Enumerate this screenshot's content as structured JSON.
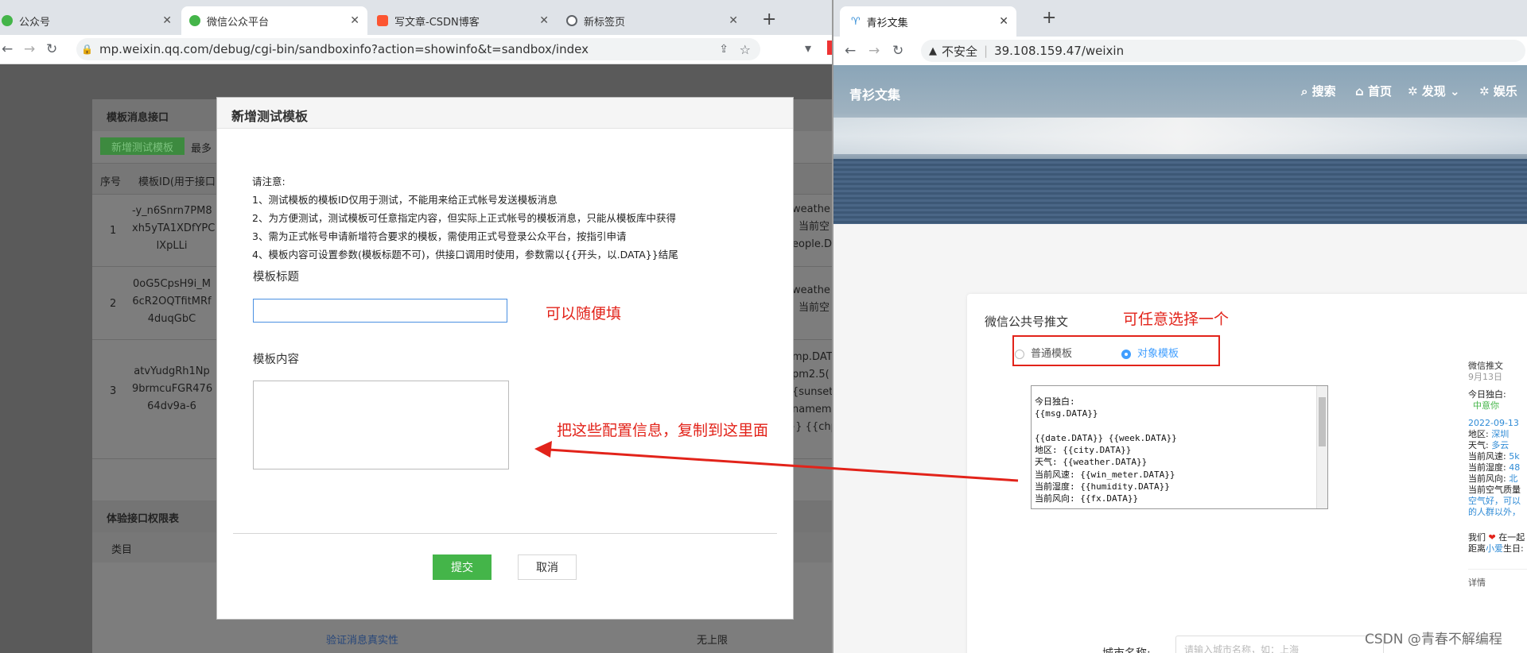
{
  "left_browser": {
    "tabs": [
      {
        "title": "公众号",
        "color": "#44b549"
      },
      {
        "title": "微信公众平台",
        "color": "#44b549"
      },
      {
        "title": "写文章-CSDN博客",
        "color": "#fc5531"
      },
      {
        "title": "新标签页",
        "color": "#5f6368"
      }
    ],
    "new_tab": "+",
    "url": "mp.weixin.qq.com/debug/cgi-bin/sandboxinfo?action=showinfo&t=sandbox/index"
  },
  "background_page": {
    "section1_title": "模板消息接口",
    "add_button": "新增测试模板",
    "limit_prefix": "最多",
    "col_index": "序号",
    "col_id": "模板ID(用于接口",
    "rows": [
      {
        "index": "1",
        "id_lines": [
          "-y_n6Snrn7PM8",
          "xh5yTA1XDfYPC",
          "lXpLLi"
        ],
        "content_lines": [
          "weathe",
          "当前空",
          "eople.D"
        ]
      },
      {
        "index": "2",
        "id_lines": [
          "0oG5CpsH9i_M",
          "6cR2OQTfitMRf",
          "4duqGbC"
        ],
        "content_lines": [
          "weathe",
          "当前空"
        ]
      },
      {
        "index": "3",
        "id_lines": [
          "atvYudgRh1Np",
          "9brmcuFGR476",
          "64dv9a-6"
        ],
        "content_lines": [
          "mp.DAT",
          "pm2.5(",
          "{sunset",
          "namemo",
          "}} {{chp"
        ]
      }
    ],
    "section2_title": "体验接口权限表",
    "category_label": "类目",
    "verify_link": "验证消息真实性",
    "no_limit": "无上限"
  },
  "modal": {
    "title": "新增测试模板",
    "close": "×",
    "notice_title": "请注意:",
    "notices": [
      "1、测试模板的模板ID仅用于测试，不能用来给正式帐号发送模板消息",
      "2、为方便测试，测试模板可任意指定内容，但实际上正式帐号的模板消息，只能从模板库中获得",
      "3、需为正式帐号申请新增符合要求的模板，需使用正式号登录公众平台，按指引申请",
      "4、模板内容可设置参数(模板标题不可)，供接口调用时使用，参数需以{{开头，以.DATA}}结尾"
    ],
    "title_label": "模板标题",
    "title_value": "",
    "content_label": "模板内容",
    "content_value": "",
    "submit": "提交",
    "cancel": "取消"
  },
  "annotations": {
    "fill_any": "可以随便填",
    "copy_here": "把这些配置信息，复制到这里面",
    "choose_any": "可任意选择一个"
  },
  "right_browser": {
    "tab_title": "青衫文集",
    "new_tab": "+",
    "insecure": "不安全",
    "url": "39.108.159.47/weixin",
    "site_name": "青衫文集",
    "nav": [
      "搜索",
      "首页",
      "发现",
      "娱乐"
    ],
    "card_title": "微信公共号推文",
    "radio_options": [
      "普通模板",
      "对象模板"
    ],
    "radio_selected": "对象模板",
    "template_text": "今日独白:\n{{msg.DATA}}\n\n{{date.DATA}} {{week.DATA}}\n地区: {{city.DATA}}\n天气: {{weather.DATA}}\n当前风速: {{win_meter.DATA}}\n当前湿度: {{humidity.DATA}}\n当前风向: {{fx.DATA}}",
    "city_label": "城市名称:",
    "city_placeholder": "请输入城市名称，如：上海",
    "preview": {
      "title": "微信推文",
      "date": "9月13日",
      "monologue_label": "今日独白:",
      "monologue": "中意你",
      "datetime": "2022-09-13",
      "area_label": "地区:",
      "area": "深圳",
      "weather_label": "天气:",
      "weather": "多云",
      "wind_speed_label": "当前风速:",
      "wind_speed": "5k",
      "humidity_label": "当前湿度:",
      "humidity": "48",
      "wind_dir_label": "当前风向:",
      "wind_dir": "北",
      "air_label": "当前空气质量",
      "air_note_1": "空气好，可以",
      "air_note_2": "的人群以外，",
      "love_prefix": "我们",
      "love_suffix": "在一起",
      "birthday_prefix": "距离",
      "birthday_name": "小爱",
      "birthday_suffix": "生日:",
      "details": "详情"
    }
  },
  "watermark": "CSDN @青春不解编程"
}
